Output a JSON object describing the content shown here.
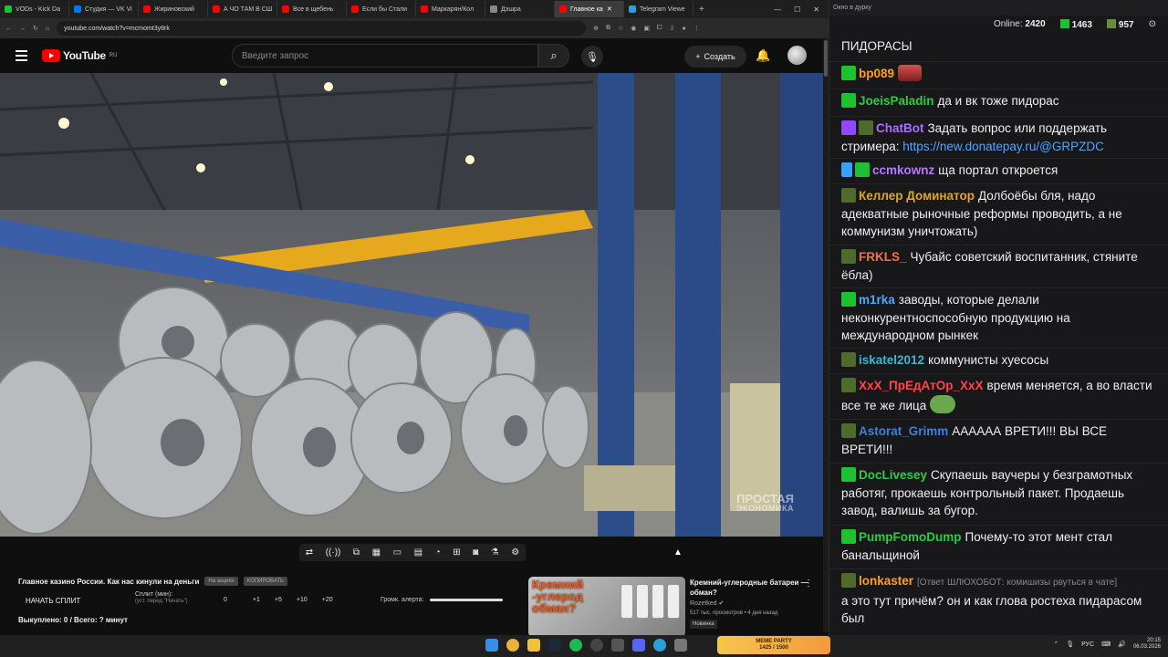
{
  "browser": {
    "tabs": [
      {
        "label": "VODs - Kick Da",
        "color": "#1ec12f"
      },
      {
        "label": "Студия — VK Vi",
        "color": "#0077ff"
      },
      {
        "label": "Жириновский",
        "color": "#ff0000"
      },
      {
        "label": "А ЧО ТАМ В СШ",
        "color": "#ff0000"
      },
      {
        "label": "Все в щебень",
        "color": "#ff0000"
      },
      {
        "label": "Если бы Стали",
        "color": "#ff0000"
      },
      {
        "label": "Маркарян/Кол",
        "color": "#ff0000"
      },
      {
        "label": "Дэшра",
        "color": "#888888"
      },
      {
        "label": "Главное ка",
        "color": "#ff0000",
        "active": true
      },
      {
        "label": "Telegram Viewe",
        "color": "#2aa0d8"
      }
    ],
    "url": "youtube.com/watch?v=mcmomt3y8rk"
  },
  "youtube": {
    "logo_text": "YouTube",
    "region": "RU",
    "search_placeholder": "Введите запрос",
    "create_label": "Создать"
  },
  "video": {
    "watermark_line1": "ПРОСТАЯ",
    "watermark_line2": "ЭКОНОМИКА",
    "title": "Главное казино России. Как нас кинули на деньги",
    "chip1": "На акциях",
    "chip2": "КОПИРОВАТЬ"
  },
  "split": {
    "start_label": "НАЧАТЬ СПЛИТ",
    "minutes_label": "Сплит (мин):",
    "minutes_hint": "(уст. перед \"Начать\")",
    "value": "0",
    "buttons": [
      "+1",
      "+5",
      "+10",
      "+20"
    ],
    "volume_label": "Громк. алерта:",
    "volume_level": 1.0,
    "bought_label": "Выкуплено: 0 / Всего: ? минут"
  },
  "recommendation": {
    "thumb_line1": "Кремний",
    "thumb_line2": "-углерод",
    "thumb_line3": "обман?",
    "title": "Кремний-углеродные батареи — обман?",
    "channel": "Rozetked",
    "stats": "517 тыс. просмотров • 4 дня назад",
    "badge": "Новинка"
  },
  "chat": {
    "header": "Окно в дурку",
    "online_label": "Online:",
    "online_value": "2420",
    "kick_count": "1463",
    "other_count": "957",
    "messages": [
      {
        "user": "",
        "color": "#efeff1",
        "text": "ПИДОРАСЫ"
      },
      {
        "user": "bp089",
        "color": "#ff9f1c",
        "text": ""
      },
      {
        "user": "JoeisPaladin",
        "color": "#2ecc40",
        "text": "да и вк тоже пидорас"
      },
      {
        "user": "ChatBot",
        "color": "#a970ff",
        "text": "Задать вопрос или поддержать стримера: ",
        "link": "https://new.donatepay.ru/@GRPZDC"
      },
      {
        "user": "ccmkownz",
        "color": "#b57bff",
        "text": "ща портал откроется"
      },
      {
        "user": "Келлер Доминатор",
        "color": "#e0a526",
        "text": "Долбоёбы бля, надо адекватные рыночные реформы проводить, а не коммунизм уничтожать)"
      },
      {
        "user": "FRKLS_",
        "color": "#ff6b4a",
        "text": "Чубайс советский воспитанник, стяните ёбла)"
      },
      {
        "user": "m1rka",
        "color": "#4ea6ff",
        "text": "заводы, которые делали неконкурентноспособную продукцию на международном рынкек"
      },
      {
        "user": "iskatel2012",
        "color": "#3ab7d6",
        "text": "коммунисты хуесосы"
      },
      {
        "user": "XxX_ПрЕдАтОр_XxX",
        "color": "#ff4545",
        "text": "время меняется, а во власти все те же лица"
      },
      {
        "user": "Astorat_Grimm",
        "color": "#3b82d9",
        "text": "АААААА ВРЕТИ!!! ВЫ ВСЕ ВРЕТИ!!!"
      },
      {
        "user": "DocLivesey",
        "color": "#2ecc40",
        "text": "Скупаешь ваучеры у безграмотных работяг, прокаешь контрольный пакет. Продаешь завод, валишь за бугор."
      },
      {
        "user": "PumpFomoDump",
        "color": "#2ecc40",
        "text": "Почему-то этот мент стал банальщиной"
      },
      {
        "user": "lonkaster",
        "color": "#ff9f1c",
        "reply": "[Ответ ШЛЮХОБОТ: комишизы рвуться в чате]",
        "text": "а это тут причём? он и как глова ростеха пидарасом был"
      }
    ]
  },
  "taskbar": {
    "meme_label": "MEME PARTY",
    "meme_progress": "1425 / 1500",
    "lang": "РУС",
    "time": "20:15",
    "date": "06.03.2026"
  }
}
